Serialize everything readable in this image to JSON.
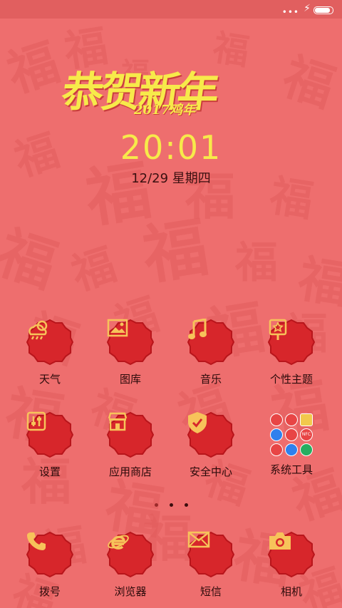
{
  "status_bar": {
    "signal": "•••",
    "charging_icon": "bolt-icon",
    "battery_level": 0.8
  },
  "banner": {
    "headline": "恭贺新年",
    "subline": "2017鸡年"
  },
  "lockscreen": {
    "time": "20:01",
    "date": "12/29  星期四"
  },
  "colors": {
    "background": "#ee6e6e",
    "badge": "#d7262b",
    "badge_ring": "#f7c35a",
    "accent": "#f7ea4a"
  },
  "apps_row1": [
    {
      "label": "天气",
      "icon": "weather-icon"
    },
    {
      "label": "图库",
      "icon": "gallery-icon"
    },
    {
      "label": "音乐",
      "icon": "music-icon"
    },
    {
      "label": "个性主题",
      "icon": "theme-icon"
    }
  ],
  "apps_row2": [
    {
      "label": "设置",
      "icon": "settings-icon"
    },
    {
      "label": "应用商店",
      "icon": "store-icon"
    },
    {
      "label": "安全中心",
      "icon": "shield-icon"
    },
    {
      "label": "系统工具",
      "icon": "folder-icon"
    }
  ],
  "folder_items": [
    "NFC"
  ],
  "dock": [
    {
      "label": "拨号",
      "icon": "phone-icon"
    },
    {
      "label": "浏览器",
      "icon": "browser-icon"
    },
    {
      "label": "短信",
      "icon": "message-icon"
    },
    {
      "label": "相机",
      "icon": "camera-icon"
    }
  ],
  "pager": {
    "pages": 3,
    "current": 2
  }
}
